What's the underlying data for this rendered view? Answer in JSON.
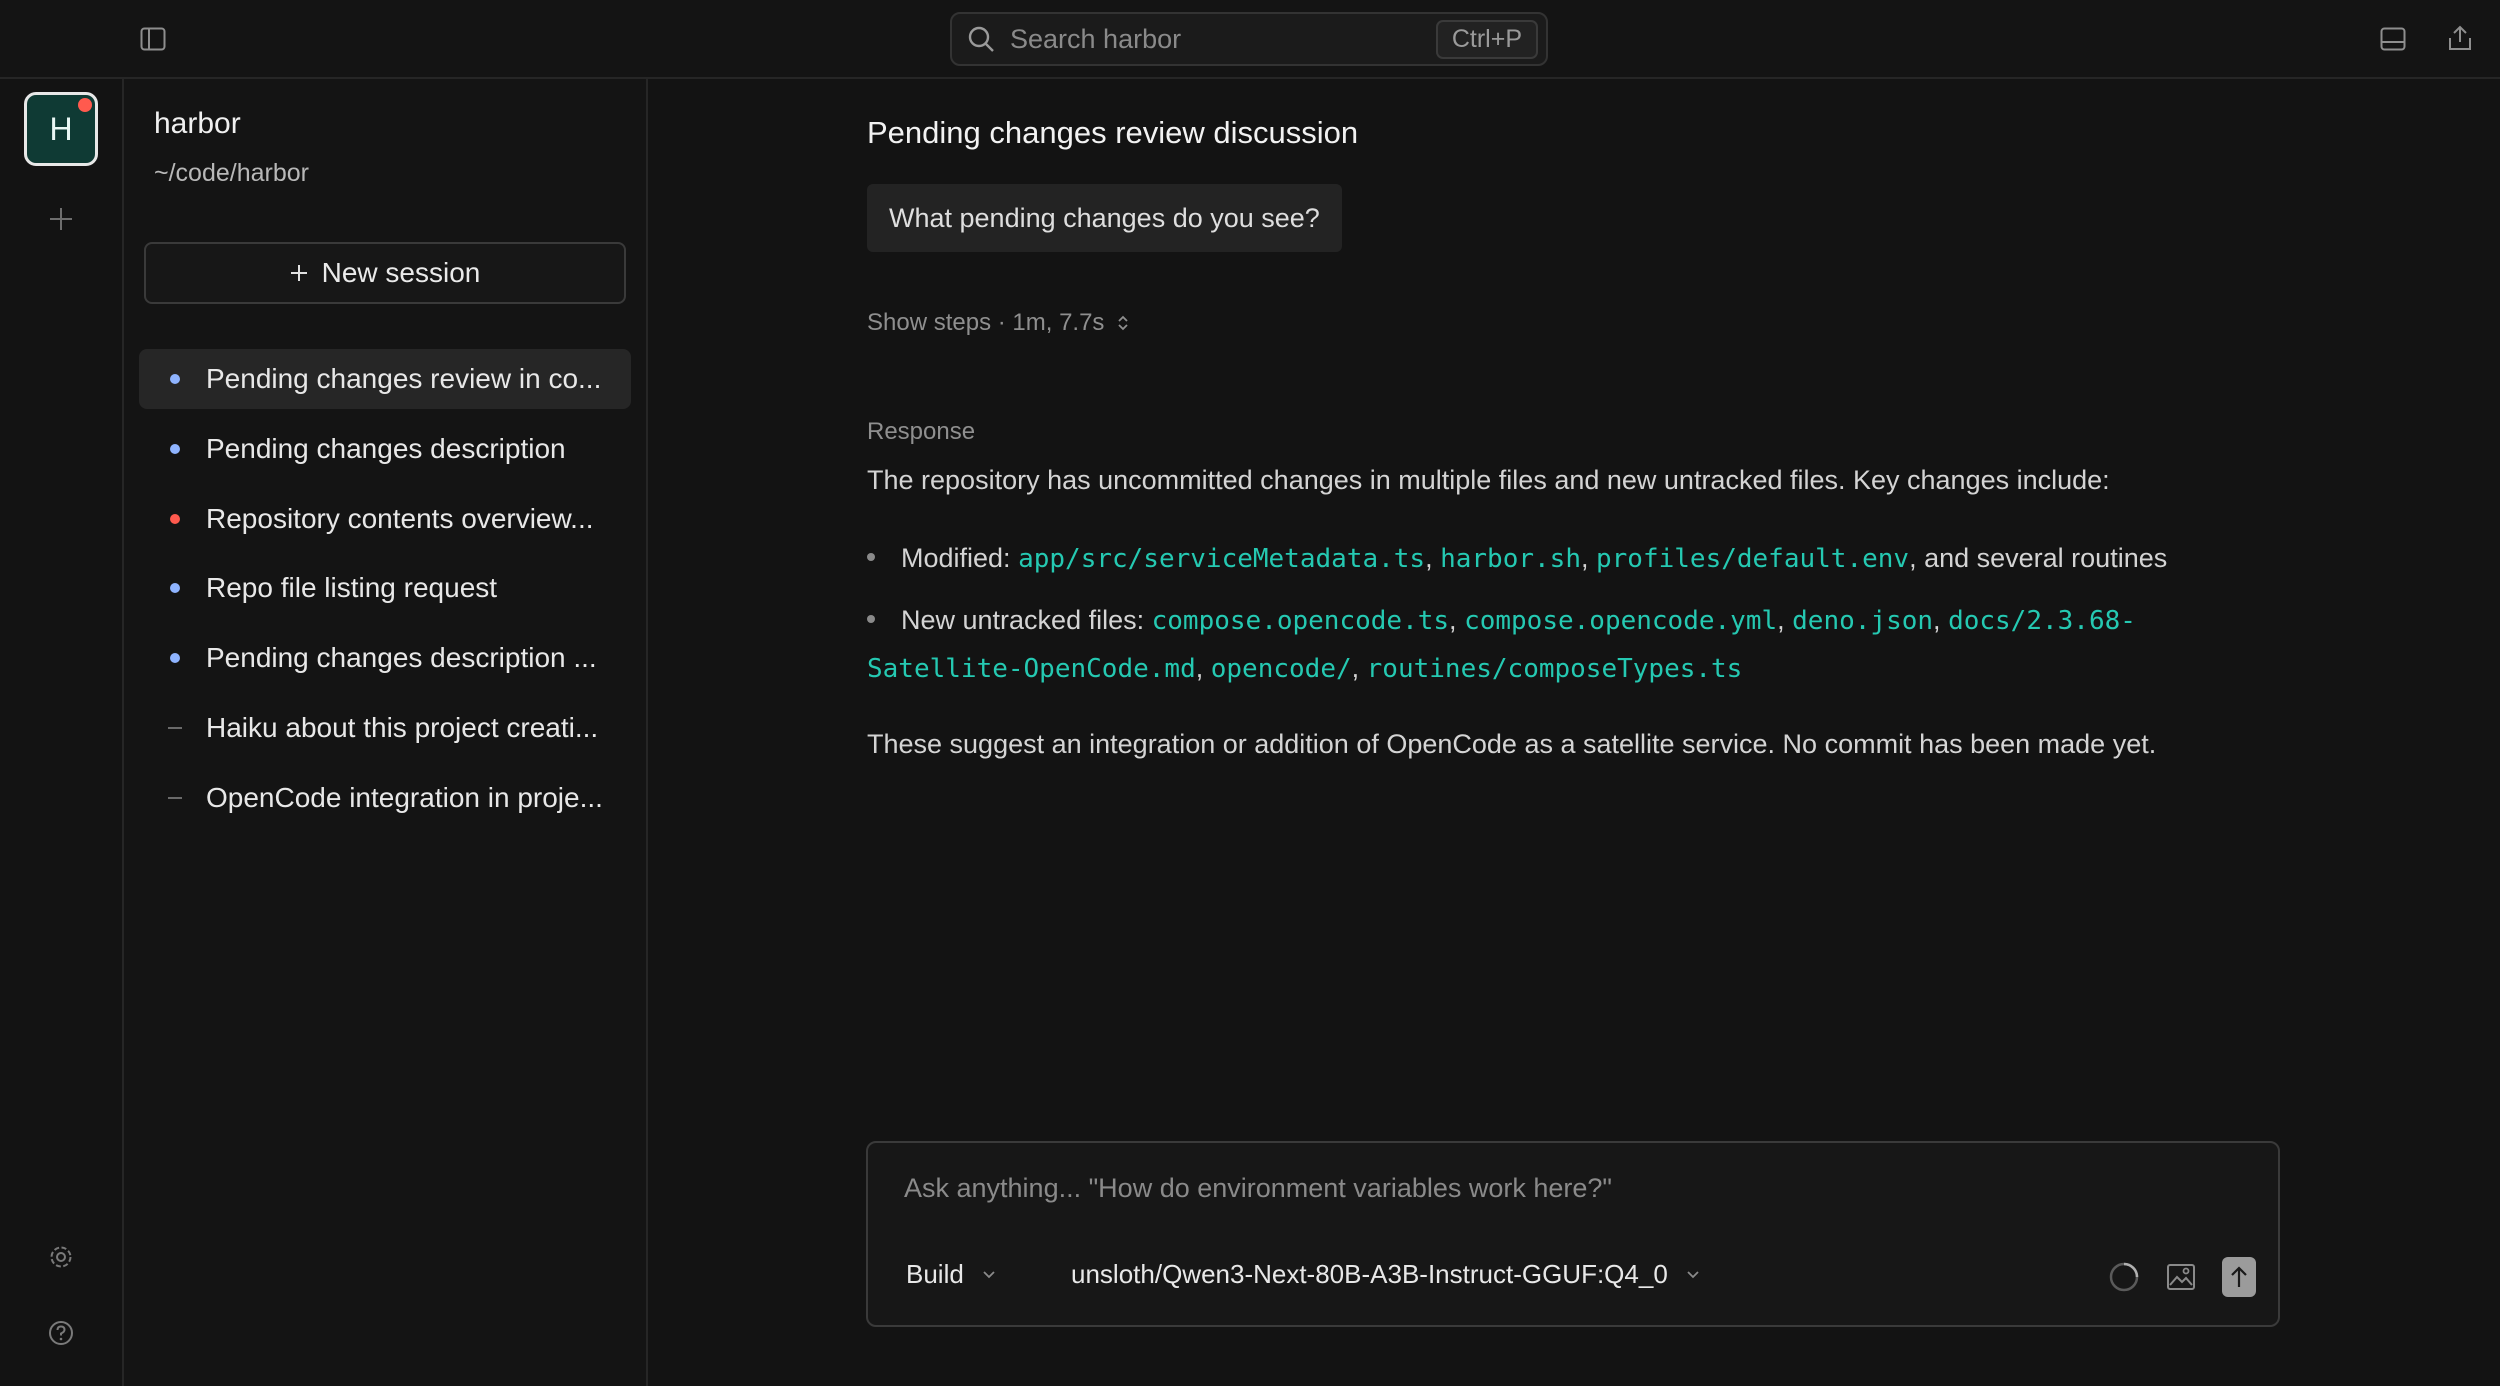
{
  "topbar": {
    "search_placeholder": "Search harbor",
    "search_shortcut": "Ctrl+P"
  },
  "rail": {
    "project_initial": "H"
  },
  "sidebar": {
    "project_name": "harbor",
    "project_path": "~/code/harbor",
    "new_session_label": "New session",
    "sessions": [
      {
        "label": "Pending changes review in co...",
        "status": "blue",
        "active": true
      },
      {
        "label": "Pending changes description",
        "status": "blue",
        "active": false
      },
      {
        "label": "Repository contents overview...",
        "status": "red",
        "active": false
      },
      {
        "label": "Repo file listing request",
        "status": "blue",
        "active": false
      },
      {
        "label": "Pending changes description ...",
        "status": "blue",
        "active": false
      },
      {
        "label": "Haiku about this project creati...",
        "status": "none",
        "active": false
      },
      {
        "label": "OpenCode integration in proje...",
        "status": "none",
        "active": false
      }
    ]
  },
  "main": {
    "title": "Pending changes review discussion",
    "question": "What pending changes do you see?",
    "steps_label": "Show steps · 1m, 7.7s",
    "response_label": "Response",
    "intro": "The repository has uncommitted changes in multiple files and new untracked files. Key changes include:",
    "modified_label": "Modified:",
    "modified_files": [
      "app/src/serviceMetadata.ts",
      "harbor.sh",
      "profiles/default.env"
    ],
    "modified_suffix": ", and several routines",
    "untracked_label": "New untracked files:",
    "untracked_files": [
      "compose.opencode.ts",
      "compose.opencode.yml",
      "deno.json",
      "docs/2.3.68-",
      "Satellite-OpenCode.md",
      "opencode/",
      "routines/composeTypes.ts"
    ],
    "conclusion": "These suggest an integration or addition of OpenCode as a satellite service. No commit has been made yet."
  },
  "composer": {
    "placeholder": "Ask anything... \"How do environment variables work here?\"",
    "mode": "Build",
    "model": "unsloth/Qwen3-Next-80B-A3B-Instruct-GGUF:Q4_0"
  },
  "colors": {
    "accent_code": "#25c9b2",
    "status_blue": "#8fb4ff",
    "status_red": "#ff5a4e"
  }
}
